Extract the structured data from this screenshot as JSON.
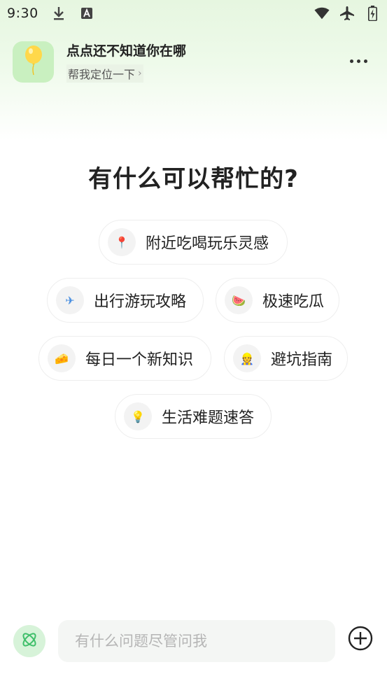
{
  "status_bar": {
    "time": "9:30",
    "icons": [
      "download-icon",
      "a-icon",
      "wifi-icon",
      "airplane-icon",
      "battery-icon"
    ]
  },
  "header": {
    "title": "点点还不知道你在哪",
    "subtitle": "帮我定位一下",
    "chevron": "›",
    "avatar_icon": "balloon-icon"
  },
  "main": {
    "title": "有什么可以帮忙的?",
    "chips": [
      {
        "label": "附近吃喝玩乐灵感",
        "icon": "pin-icon",
        "glyph": "📍"
      },
      {
        "label": "出行游玩攻略",
        "icon": "airplane-icon",
        "glyph": "✈"
      },
      {
        "label": "极速吃瓜",
        "icon": "watermelon-icon",
        "glyph": "🍉"
      },
      {
        "label": "每日一个新知识",
        "icon": "cheese-icon",
        "glyph": "🧀"
      },
      {
        "label": "避坑指南",
        "icon": "worker-icon",
        "glyph": "👷"
      },
      {
        "label": "生活难题速答",
        "icon": "lightbulb-icon",
        "glyph": "💡"
      }
    ]
  },
  "bottom": {
    "placeholder": "有什么问题尽管问我",
    "ai_icon": "atom-icon",
    "plus_icon": "plus-circle-icon"
  },
  "colors": {
    "accent_green": "#5cc77a",
    "avatar_bg": "#c9f0c0",
    "header_gradient": "#e6f6e0"
  }
}
